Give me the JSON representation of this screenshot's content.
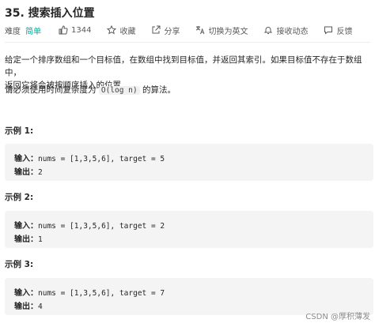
{
  "problem": {
    "title": "35. 搜索插入位置",
    "difficulty_label": "难度",
    "difficulty_value": "简单",
    "likes": "1344",
    "favorite_label": "收藏",
    "share_label": "分享",
    "translate_label": "切换为英文",
    "notify_label": "接收动态",
    "feedback_label": "反馈",
    "accent_color": "#00af9b"
  },
  "description": {
    "line1": "给定一个排序数组和一个目标值，在数组中找到目标值，并返回其索引。如果目标值不存在于数组中，",
    "line2": "返回它将会被按顺序插入的位置。",
    "req_prefix": "请必须使用时间复杂度为 ",
    "req_code": "O(log n)",
    "req_suffix": " 的算法。"
  },
  "examples": [
    {
      "title": "示例 1:",
      "input_label": "输入：",
      "input": "nums = [1,3,5,6], target = 5",
      "output_label": "输出：",
      "output": "2"
    },
    {
      "title": "示例 2:",
      "input_label": "输入：",
      "input": "nums = [1,3,5,6], target = 2",
      "output_label": "输出：",
      "output": "1"
    },
    {
      "title": "示例 3:",
      "input_label": "输入：",
      "input": "nums = [1,3,5,6], target = 7",
      "output_label": "输出：",
      "output": "4"
    }
  ],
  "watermark": "CSDN @厚积薄发​"
}
